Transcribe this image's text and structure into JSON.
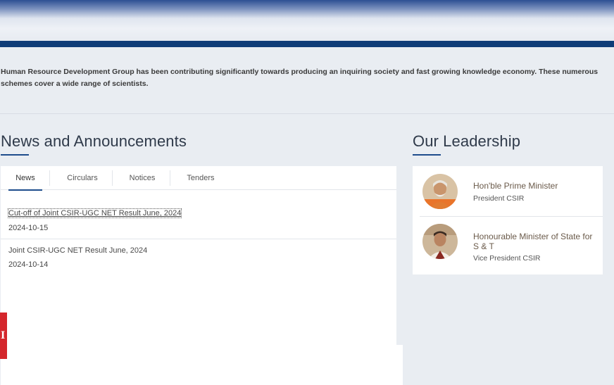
{
  "intro": {
    "text": "Human Resource Development Group has been contributing significantly towards producing an inquiring society and fast growing knowledge economy. These numerous schemes cover a wide range of scientists."
  },
  "news": {
    "title": "News and Announcements",
    "tabs": [
      {
        "label": "News"
      },
      {
        "label": "Circulars"
      },
      {
        "label": "Notices"
      },
      {
        "label": "Tenders"
      }
    ],
    "items": [
      {
        "title": "Cut-off of Joint CSIR-UGC NET Result June, 2024",
        "date": "2024-10-15"
      },
      {
        "title": "Joint CSIR-UGC NET Result June, 2024",
        "date": "2024-10-14"
      }
    ]
  },
  "leadership": {
    "title": "Our Leadership",
    "leaders": [
      {
        "role": "Hon'ble Prime Minister",
        "position": "President CSIR",
        "avatar": "prime-minister-photo"
      },
      {
        "role_line1": "Honourable Minister of State for",
        "role_line2": "S & T",
        "position": "Vice President CSIR",
        "avatar": "minister-photo"
      }
    ]
  },
  "badge": {
    "letter": "I"
  },
  "colors": {
    "accent": "#1d4c8c",
    "nav": "#0f3c78",
    "badge": "#d4262c"
  }
}
